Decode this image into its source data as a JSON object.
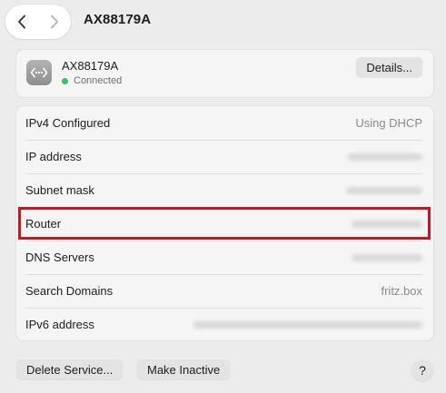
{
  "header": {
    "title": "AX88179A",
    "back_icon": "chevron-left-icon",
    "forward_icon": "chevron-right-icon"
  },
  "service": {
    "name": "AX88179A",
    "status": "Connected",
    "status_color": "#34c759",
    "icon": "ethernet-icon",
    "details_label": "Details..."
  },
  "rows": [
    {
      "label": "IPv4 Configured",
      "value": "Using DHCP",
      "redacted": false
    },
    {
      "label": "IP address",
      "value": "",
      "redacted": true
    },
    {
      "label": "Subnet mask",
      "value": "",
      "redacted": true
    },
    {
      "label": "Router",
      "value": "",
      "redacted": true
    },
    {
      "label": "DNS Servers",
      "value": "",
      "redacted": true
    },
    {
      "label": "Search Domains",
      "value": "fritz.box",
      "redacted": false
    },
    {
      "label": "IPv6 address",
      "value": "",
      "redacted": true
    }
  ],
  "highlight": {
    "row": "Router",
    "color": "#c4181e"
  },
  "footer": {
    "delete_label": "Delete Service...",
    "inactive_label": "Make Inactive",
    "help_label": "?"
  }
}
